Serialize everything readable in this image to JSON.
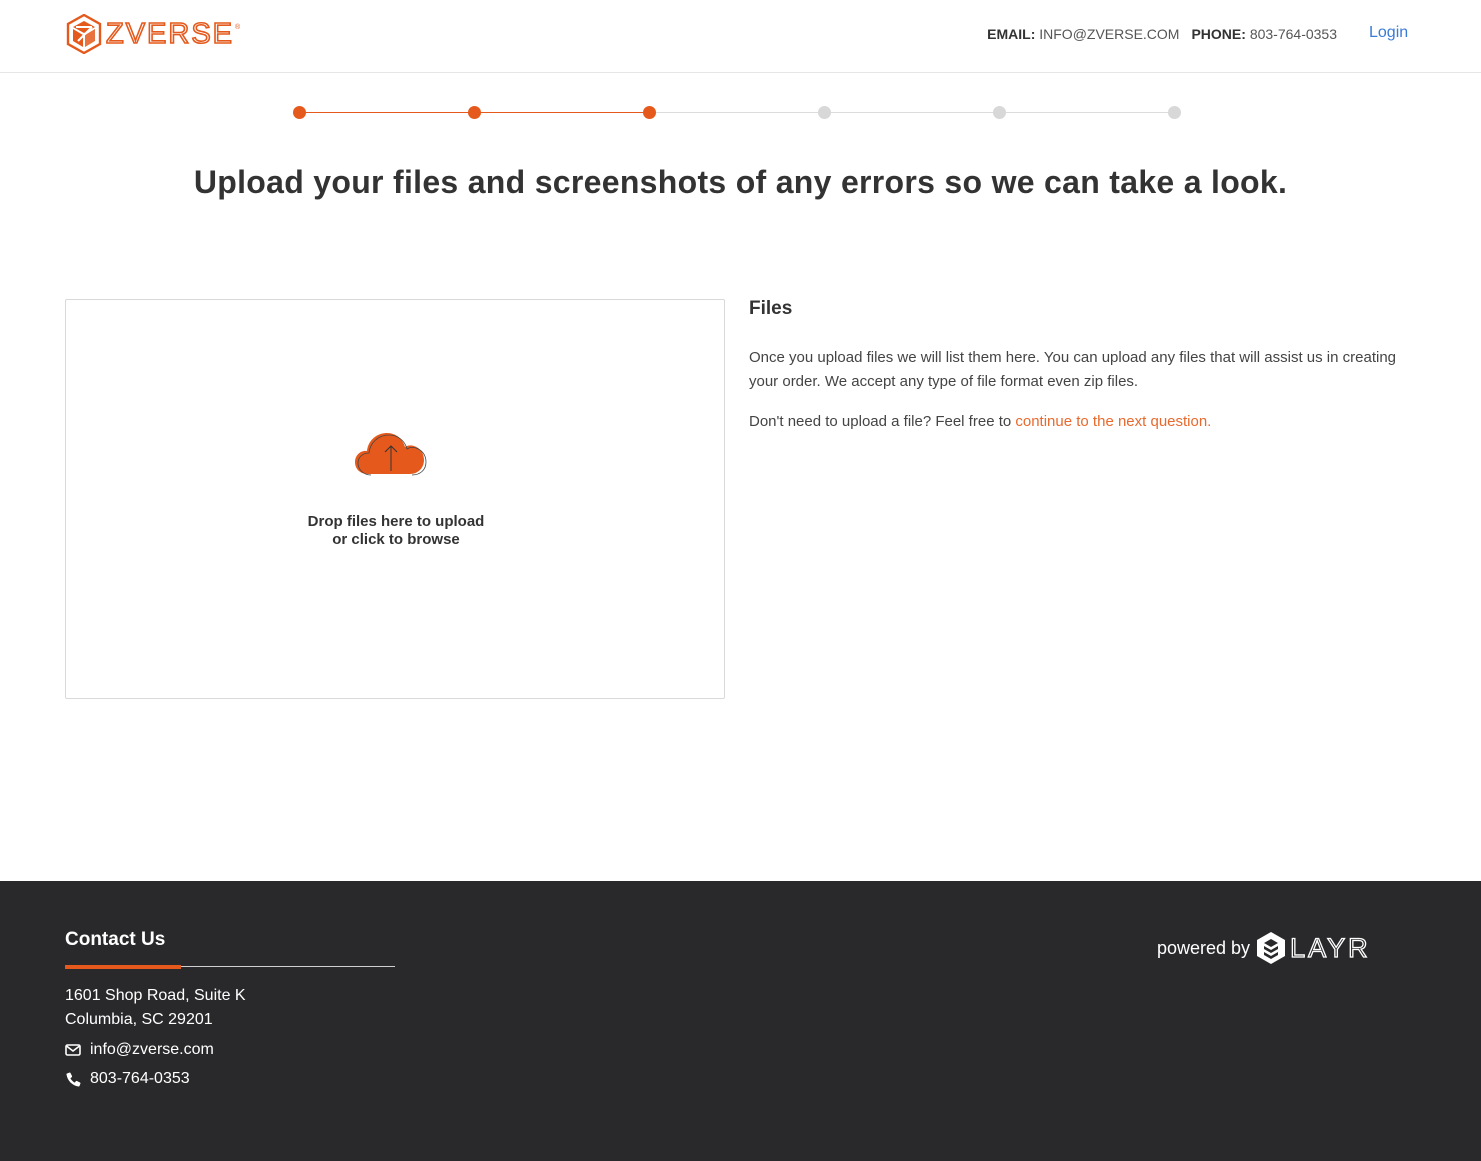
{
  "header": {
    "logo_text": "ZVERSE",
    "logo_reg": "®",
    "email_label": "EMAIL:",
    "email_value": "INFO@ZVERSE.COM",
    "phone_label": "PHONE:",
    "phone_value": "803-764-0353",
    "login_label": "Login"
  },
  "progress": {
    "total_steps": 6,
    "completed_steps": 3
  },
  "heading": "Upload your files and screenshots of any errors so we can take a look.",
  "dropzone": {
    "line1": "Drop files here to upload",
    "line2": "or click to browse"
  },
  "files": {
    "title": "Files",
    "description": "Once you upload files we will list them here. You can upload any files that will assist us in creating your order. We accept any type of file format even zip files.",
    "skip_prefix": "Don't need to upload a file? Feel free to ",
    "skip_link": "continue to the next question."
  },
  "footer": {
    "title": "Contact Us",
    "address_line1": "1601 Shop Road, Suite K",
    "address_line2": "Columbia, SC 29201",
    "email": "info@zverse.com",
    "phone": "803-764-0353",
    "powered_by": "powered by",
    "powered_brand": "LAYR"
  },
  "colors": {
    "accent": "#e55a1c",
    "link_blue": "#3a7bd5",
    "footer_bg": "#29292b",
    "step_inactive": "#d8d8d8"
  },
  "icons": [
    "zverse-logo-icon",
    "upload-cloud-icon",
    "envelope-icon",
    "phone-icon",
    "layr-logo-icon"
  ]
}
